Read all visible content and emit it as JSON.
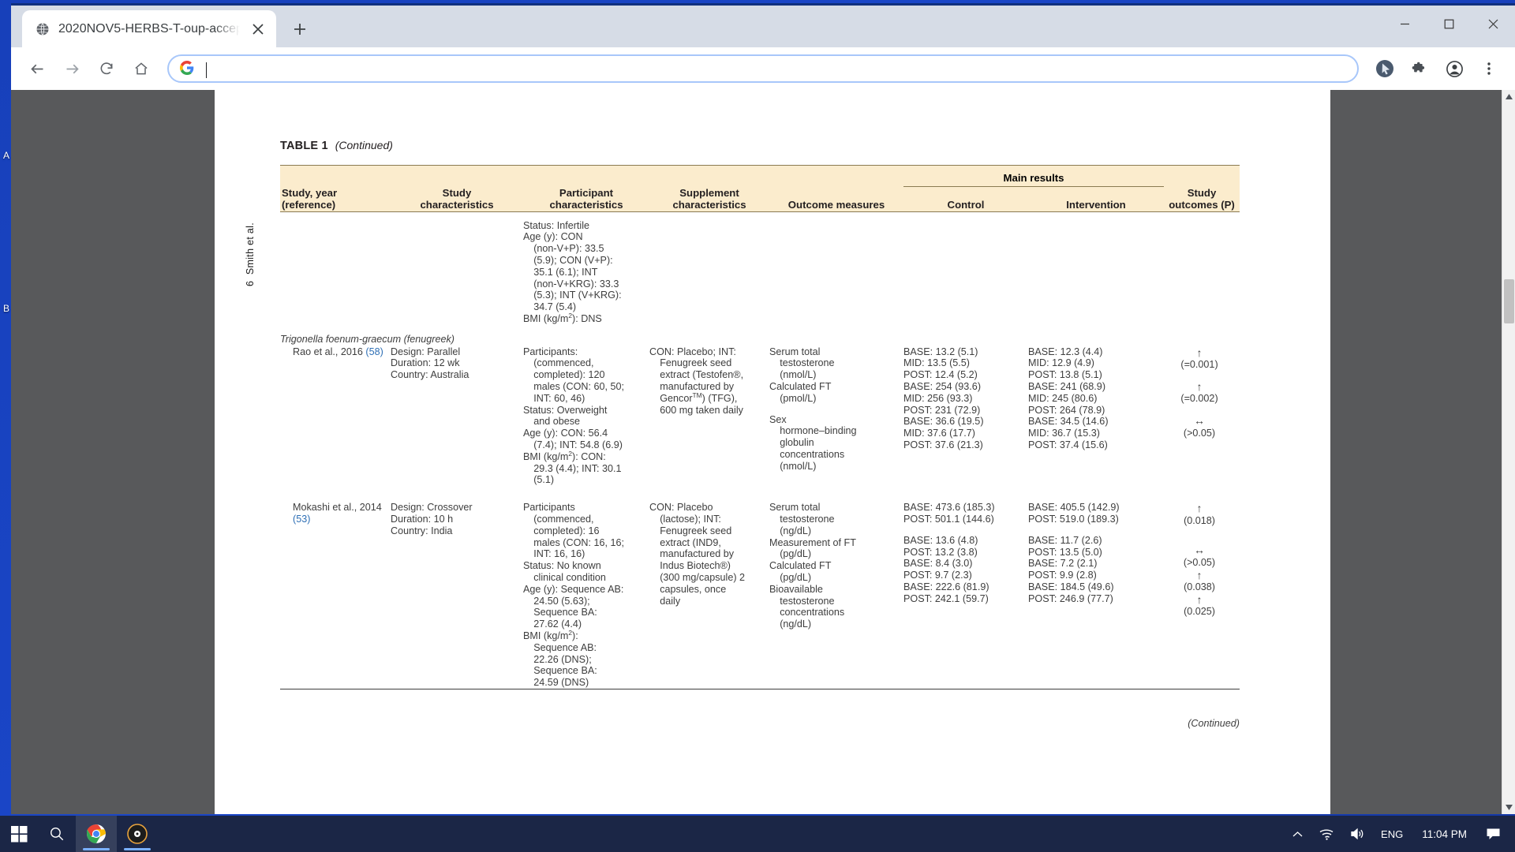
{
  "desktop": {
    "partial_icon_labels": [
      "A",
      "B"
    ]
  },
  "browser": {
    "tab": {
      "title": "2020NOV5-HERBS-T-oup-accept",
      "favicon_icon": "globe-icon",
      "close_icon": "close-icon"
    },
    "new_tab_label": "+",
    "window_controls": {
      "minimize": "—",
      "maximize": "☐",
      "close": "✕"
    },
    "toolbar": {
      "back_icon": "arrow-left-icon",
      "forward_icon": "arrow-right-icon",
      "reload_icon": "reload-icon",
      "home_icon": "home-icon",
      "omnibox_value": "",
      "omnibox_placeholder": "",
      "search_engine_icon": "google-g-icon",
      "cursor_icon": "cursor-pointer-icon",
      "extensions_icon": "puzzle-piece-icon",
      "profile_icon": "account-avatar-icon",
      "menu_icon": "three-dot-menu-icon"
    }
  },
  "document": {
    "running_head": {
      "page_number": "6",
      "authors": "Smith et al."
    },
    "caption": {
      "label": "TABLE 1",
      "continued": "(Continued)"
    },
    "footer_continued": "(Continued)",
    "table": {
      "columns": [
        {
          "line1": "Study, year",
          "line2": "(reference)"
        },
        {
          "line1": "Study",
          "line2": "characteristics"
        },
        {
          "line1": "Participant",
          "line2": "characteristics"
        },
        {
          "line1": "Supplement",
          "line2": "characteristics"
        },
        {
          "line1": "",
          "line2": "Outcome measures"
        },
        {
          "line1": "",
          "line2": "Control"
        },
        {
          "line1": "",
          "line2": "Intervention"
        }
      ],
      "main_results_header": "Main results",
      "study_outcomes_header": {
        "line1": "Study",
        "line2": "outcomes (P)"
      },
      "rows": [
        {
          "kind": "continuation",
          "study": "",
          "study_characteristics": "",
          "participant_characteristics": [
            "Status: Infertile",
            "Age (y): CON",
            "(non-V+P): 33.5",
            "(5.9); CON (V+P):",
            "35.1 (6.1); INT",
            "(non-V+KRG): 33.3",
            "(5.3); INT (V+KRG):",
            "34.7 (5.4)",
            "BMI (kg/m2): DNS"
          ],
          "supplement_characteristics": [],
          "outcome_measures": [],
          "control": [],
          "intervention": [],
          "study_outcomes": []
        },
        {
          "kind": "species",
          "species_name": "Trigonella foenum-graecum",
          "common_name": "(fenugreek)"
        },
        {
          "kind": "study",
          "study": "Rao et al., 2016",
          "study_ref": "(58)",
          "study_characteristics": [
            "Design: Parallel",
            "Duration: 12 wk",
            "Country: Australia"
          ],
          "participant_characteristics": [
            "Participants:",
            "(commenced,",
            "completed): 120",
            "males (CON: 60, 50;",
            "INT: 60, 46)",
            "Status: Overweight",
            "and obese",
            "Age (y): CON: 56.4",
            "(7.4); INT: 54.8 (6.9)",
            "BMI (kg/m2): CON:",
            "29.3 (4.4); INT: 30.1",
            "(5.1)"
          ],
          "supplement_characteristics": [
            "CON: Placebo; INT:",
            "Fenugreek seed",
            "extract (Testofen®,",
            "manufactured by",
            "GencorTM) (TFG),",
            "600 mg taken daily"
          ],
          "outcome_groups": [
            {
              "measure": [
                "Serum total",
                "testosterone",
                "(nmol/L)"
              ],
              "control": [
                "BASE: 13.2 (5.1)",
                "MID: 13.5 (5.5)",
                "POST: 12.4 (5.2)"
              ],
              "intervention": [
                "BASE: 12.3 (4.4)",
                "MID: 12.9 (4.9)",
                "POST: 13.8 (5.1)"
              ],
              "outcome_symbol": "↑",
              "outcome_p": "(=0.001)"
            },
            {
              "measure": [
                "Calculated FT",
                "(pmol/L)"
              ],
              "control": [
                "BASE: 254 (93.6)",
                "MID: 256 (93.3)",
                "POST: 231 (72.9)"
              ],
              "intervention": [
                "BASE: 241 (68.9)",
                "MID: 245 (80.6)",
                "POST: 264 (78.9)"
              ],
              "outcome_symbol": "↑",
              "outcome_p": "(=0.002)"
            },
            {
              "measure": [
                "Sex",
                "hormone–binding",
                "globulin",
                "concentrations",
                "(nmol/L)"
              ],
              "control": [
                "BASE: 36.6 (19.5)",
                "MID: 37.6 (17.7)",
                "POST: 37.6 (21.3)"
              ],
              "intervention": [
                "BASE: 34.5 (14.6)",
                "MID: 36.7 (15.3)",
                "POST: 37.4 (15.6)"
              ],
              "outcome_symbol": "↔",
              "outcome_p": "(>0.05)"
            }
          ]
        },
        {
          "kind": "study",
          "study": "Mokashi et al., 2014",
          "study_ref": "(53)",
          "study_characteristics": [
            "Design: Crossover",
            "Duration: 10 h",
            "Country: India"
          ],
          "participant_characteristics": [
            "Participants",
            "(commenced,",
            "completed): 16",
            "males (CON: 16, 16;",
            "INT: 16, 16)",
            "Status: No known",
            "clinical condition",
            "Age (y): Sequence AB:",
            "24.50 (5.63);",
            "Sequence BA:",
            "27.62 (4.4)",
            "BMI (kg/m2):",
            "Sequence AB:",
            "22.26 (DNS);",
            "Sequence BA:",
            "24.59 (DNS)"
          ],
          "supplement_characteristics": [
            "CON: Placebo",
            "(lactose); INT:",
            "Fenugreek seed",
            "extract (IND9,",
            "manufactured by",
            "Indus Biotech®)",
            "(300 mg/capsule) 2",
            "capsules, once",
            "daily"
          ],
          "outcome_groups": [
            {
              "measure": [
                "Serum total",
                "testosterone",
                "(ng/dL)"
              ],
              "control": [
                "BASE: 473.6 (185.3)",
                "POST: 501.1 (144.6)"
              ],
              "intervention": [
                "BASE: 405.5 (142.9)",
                "POST: 519.0 (189.3)"
              ],
              "outcome_symbol": "↑",
              "outcome_p": "(0.018)"
            },
            {
              "measure": [
                "Measurement of FT",
                "(pg/dL)"
              ],
              "control": [
                "BASE: 13.6 (4.8)",
                "POST: 13.2 (3.8)"
              ],
              "intervention": [
                "BASE: 11.7 (2.6)",
                "POST: 13.5 (5.0)"
              ],
              "outcome_symbol": "↔",
              "outcome_p": "(>0.05)"
            },
            {
              "measure": [
                "Calculated FT",
                "(pg/dL)"
              ],
              "control": [
                "BASE: 8.4 (3.0)",
                "POST: 9.7 (2.3)"
              ],
              "intervention": [
                "BASE: 7.2 (2.1)",
                "POST: 9.9 (2.8)"
              ],
              "outcome_symbol": "↑",
              "outcome_p": "(0.038)"
            },
            {
              "measure": [
                "Bioavailable",
                "testosterone",
                "concentrations",
                "(ng/dL)"
              ],
              "control": [
                "BASE: 222.6 (81.9)",
                "POST: 242.1 (59.7)"
              ],
              "intervention": [
                "BASE: 184.5 (49.6)",
                "POST: 246.9 (77.7)"
              ],
              "outcome_symbol": "↑",
              "outcome_p": "(0.025)"
            }
          ]
        }
      ]
    }
  },
  "taskbar": {
    "start_icon": "windows-start-icon",
    "search_icon": "search-icon",
    "apps": [
      {
        "name": "chrome-taskbar-icon",
        "active": true
      },
      {
        "name": "media-player-taskbar-icon",
        "active": false
      }
    ],
    "tray": {
      "show_hidden_icon": "chevron-up-icon",
      "network_icon": "wifi-icon",
      "volume_icon": "speaker-icon",
      "language": "ENG",
      "clock": "11:04 PM",
      "notifications_icon": "notification-speech-icon"
    }
  },
  "colors": {
    "table_header_bg": "#fbeccd",
    "table_rule": "#8a7a52",
    "link": "#2e6fb5",
    "taskbar_bg": "#1b2646",
    "viewport_bg": "#58595b",
    "omnibox_border": "#a8c7fa"
  }
}
